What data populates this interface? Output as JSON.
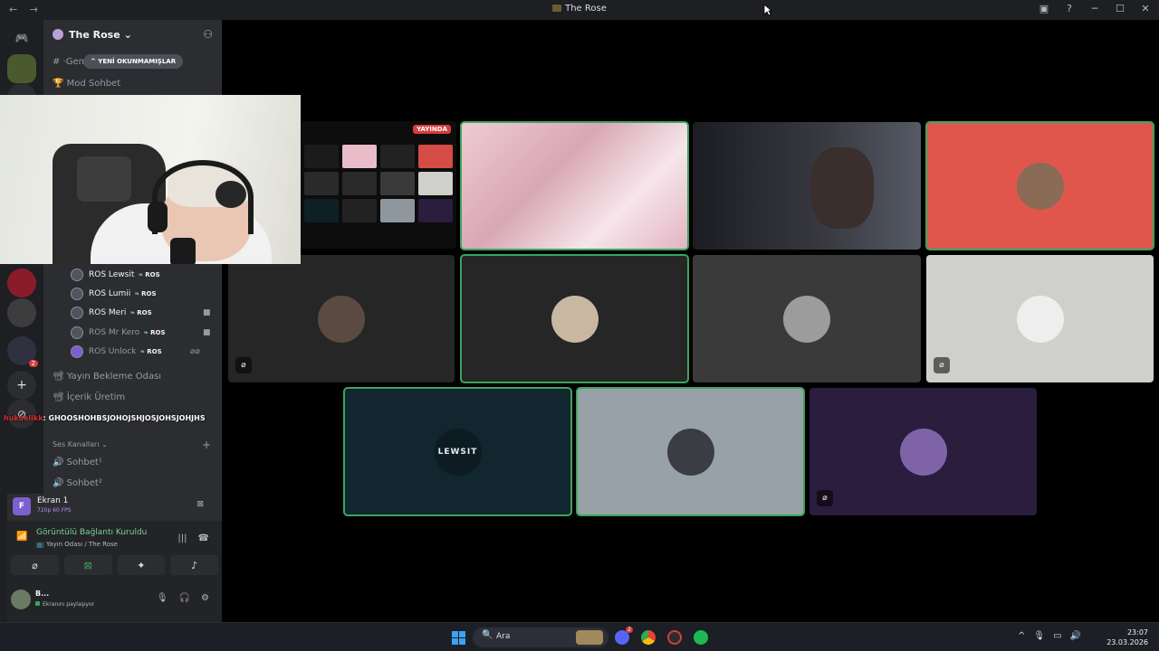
{
  "window": {
    "title": "The Rose",
    "nav_back": "←",
    "nav_forward": "→",
    "icons": [
      "inbox-icon",
      "help-icon",
      "minimize-icon",
      "maximize-icon",
      "close-icon"
    ],
    "help_glyph": "?",
    "minimize_glyph": "─",
    "maximize_glyph": "☐",
    "close_glyph": "✕",
    "inbox_glyph": "▣"
  },
  "rail": {
    "home_glyph": "🎮",
    "add_glyph": "+",
    "discover_glyph": "⊘",
    "badge_count": "2"
  },
  "server": {
    "name": "The Rose",
    "chevron": "⌄",
    "add_member_glyph": "⚇"
  },
  "unread_pill": "^ YENİ OKUNMAMIŞLAR",
  "channels": {
    "top_text": "# ·Genel",
    "mod": "🏆 Mod Sohbet",
    "waiting": "📽 Yayın Bekleme Odası",
    "content": "📽 İçerik Üretim",
    "category": "Ses Kanalları",
    "voice1": "🔊 Sohbet¹",
    "voice2": "🔊 Sohbet²"
  },
  "members": [
    {
      "name": "ROS Lewsit",
      "tag": "ROS",
      "dim": false
    },
    {
      "name": "ROS Lumii",
      "tag": "ROS",
      "dim": false
    },
    {
      "name": "ROS Meri",
      "tag": "ROS",
      "dim": false
    },
    {
      "name": "ROS Mr Kero",
      "tag": "ROS",
      "dim": true
    },
    {
      "name": "ROS Unlock",
      "tag": "ROS",
      "dim": true
    }
  ],
  "ticker": {
    "nick": "hukoelikk",
    "message": ": GHOOSHOHBSJOHOJSHJOSJOHSJOHJHS"
  },
  "voice_panel": {
    "screen_initial": "F",
    "screen_name": "Ekran 1",
    "screen_quality": "720p 60 FPS",
    "connected_title": "Görüntülü Bağlantı Kuruldu",
    "connected_sub": "📺 Yayın Odası / The Rose",
    "signal_glyph": "📶",
    "noise_glyph": "|||",
    "disconnect_glyph": "☎",
    "btn_camera": "⌀",
    "btn_share": "⊠",
    "btn_activity": "✦",
    "btn_soundboard": "♪",
    "user_name": "B...",
    "user_status": "Ekranını paylaşıyor",
    "mic_glyph": "🎙",
    "headset_glyph": "🎧",
    "settings_glyph": "⚙"
  },
  "stage": {
    "live_badge": "YAYINDA",
    "tiles": [
      {
        "id": "screen-share",
        "color": "#0d0d0d",
        "speaking": false
      },
      {
        "id": "pink-cam",
        "color": "#e7bcc4",
        "speaking": true
      },
      {
        "id": "dark-cam",
        "color": "#2b2c30",
        "speaking": false
      },
      {
        "id": "red-avatar",
        "color": "#e0564d",
        "speaking": true
      },
      {
        "id": "user-a",
        "color": "#262626",
        "speaking": false,
        "muted": true
      },
      {
        "id": "user-b",
        "color": "#262626",
        "speaking": true
      },
      {
        "id": "user-c",
        "color": "#3a3a3a",
        "speaking": false
      },
      {
        "id": "user-d",
        "color": "#cfcfcb",
        "speaking": false,
        "muted": true
      },
      {
        "id": "lewsit",
        "color": "#11262f",
        "speaking": true
      },
      {
        "id": "grey-user",
        "color": "#99a1a8",
        "speaking": true
      },
      {
        "id": "purple-user",
        "color": "#2a1d3d",
        "speaking": false,
        "muted": true
      }
    ],
    "lewsit_label": "LEWSIT",
    "muted_glyph": "⌀"
  },
  "taskbar": {
    "search_glyph": "🔍",
    "search_text": "Ara",
    "tray_chevron": "^",
    "mic_glyph": "🎙",
    "display_glyph": "▭",
    "volume_glyph": "🔊",
    "time": "23:07",
    "date": "23.03.2026",
    "discord_badge": "2"
  }
}
